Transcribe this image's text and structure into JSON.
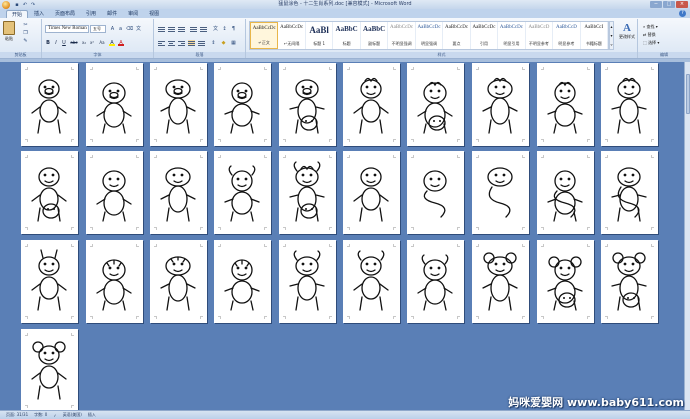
{
  "window": {
    "title": "猛鼠涂色 - 十二生肖系列.doc [兼容模式] - Microsoft Word",
    "quick_access": [
      "save-icon",
      "undo-icon",
      "redo-icon"
    ],
    "controls": [
      "−",
      "□",
      "×"
    ]
  },
  "tabs": [
    "开始",
    "插入",
    "页面布局",
    "引用",
    "邮件",
    "审阅",
    "视图"
  ],
  "active_tab": "开始",
  "ribbon": {
    "clipboard": {
      "label": "剪贴板",
      "paste": "粘贴"
    },
    "font": {
      "label": "字体",
      "font_name": "Times New Roman",
      "font_size": "五号",
      "buttons": [
        "B",
        "I",
        "U",
        "abc",
        "x₂",
        "x²",
        "Aa",
        "A",
        "A"
      ]
    },
    "paragraph": {
      "label": "段落"
    },
    "styles": {
      "label": "样式",
      "items": [
        {
          "sample": "AaBbCcDc",
          "name": "↵正文",
          "kind": "normal",
          "selected": true
        },
        {
          "sample": "AaBbCcDc",
          "name": "↵无间隔",
          "kind": "normal"
        },
        {
          "sample": "AaBl",
          "name": "标题 1",
          "kind": "big"
        },
        {
          "sample": "AaBbC",
          "name": "标题",
          "kind": "mid"
        },
        {
          "sample": "AaBbC",
          "name": "副标题",
          "kind": "mid"
        },
        {
          "sample": "AaBbCcDc",
          "name": "不明显强调",
          "kind": "light"
        },
        {
          "sample": "AaBbCcDc",
          "name": "明显强调",
          "kind": "blue"
        },
        {
          "sample": "AaBbCcDc",
          "name": "要点",
          "kind": "normal"
        },
        {
          "sample": "AaBbCcDc",
          "name": "引用",
          "kind": "normal"
        },
        {
          "sample": "AaBbCcDc",
          "name": "明显引用",
          "kind": "blue"
        },
        {
          "sample": "AaBbCcD",
          "name": "不明显参考",
          "kind": "light"
        },
        {
          "sample": "AaBbCcD",
          "name": "明显参考",
          "kind": "blue"
        },
        {
          "sample": "AaBbCcI",
          "name": "书籍标题",
          "kind": "normal"
        }
      ],
      "change_styles": "更改样式"
    },
    "editing": {
      "label": "编辑",
      "find": "查找 ▾",
      "replace": "替换",
      "select": "选择 ▾"
    }
  },
  "status": {
    "page": "页面: 31/31",
    "words": "字数: 0",
    "language": "英语(美国)",
    "mode": "插入"
  },
  "watermark": "妈咪爱婴网 www.baby611.com",
  "pages": [
    "pig",
    "pig-suit",
    "pig-overalls",
    "pig-round",
    "dog-pig",
    "rooster",
    "rooster-chick",
    "chick",
    "rooster-head",
    "duck",
    "monkey-pair",
    "monkey-small",
    "monkey",
    "goat",
    "bird-goat",
    "horse",
    "snake",
    "snake-coil",
    "dragon",
    "dragon-small",
    "rabbit",
    "tiger-cub",
    "tiger",
    "tiger-big",
    "ox",
    "ox-standing",
    "ox-horns",
    "mouse",
    "mouse-pair",
    "mouse-stack",
    "mouse"
  ]
}
